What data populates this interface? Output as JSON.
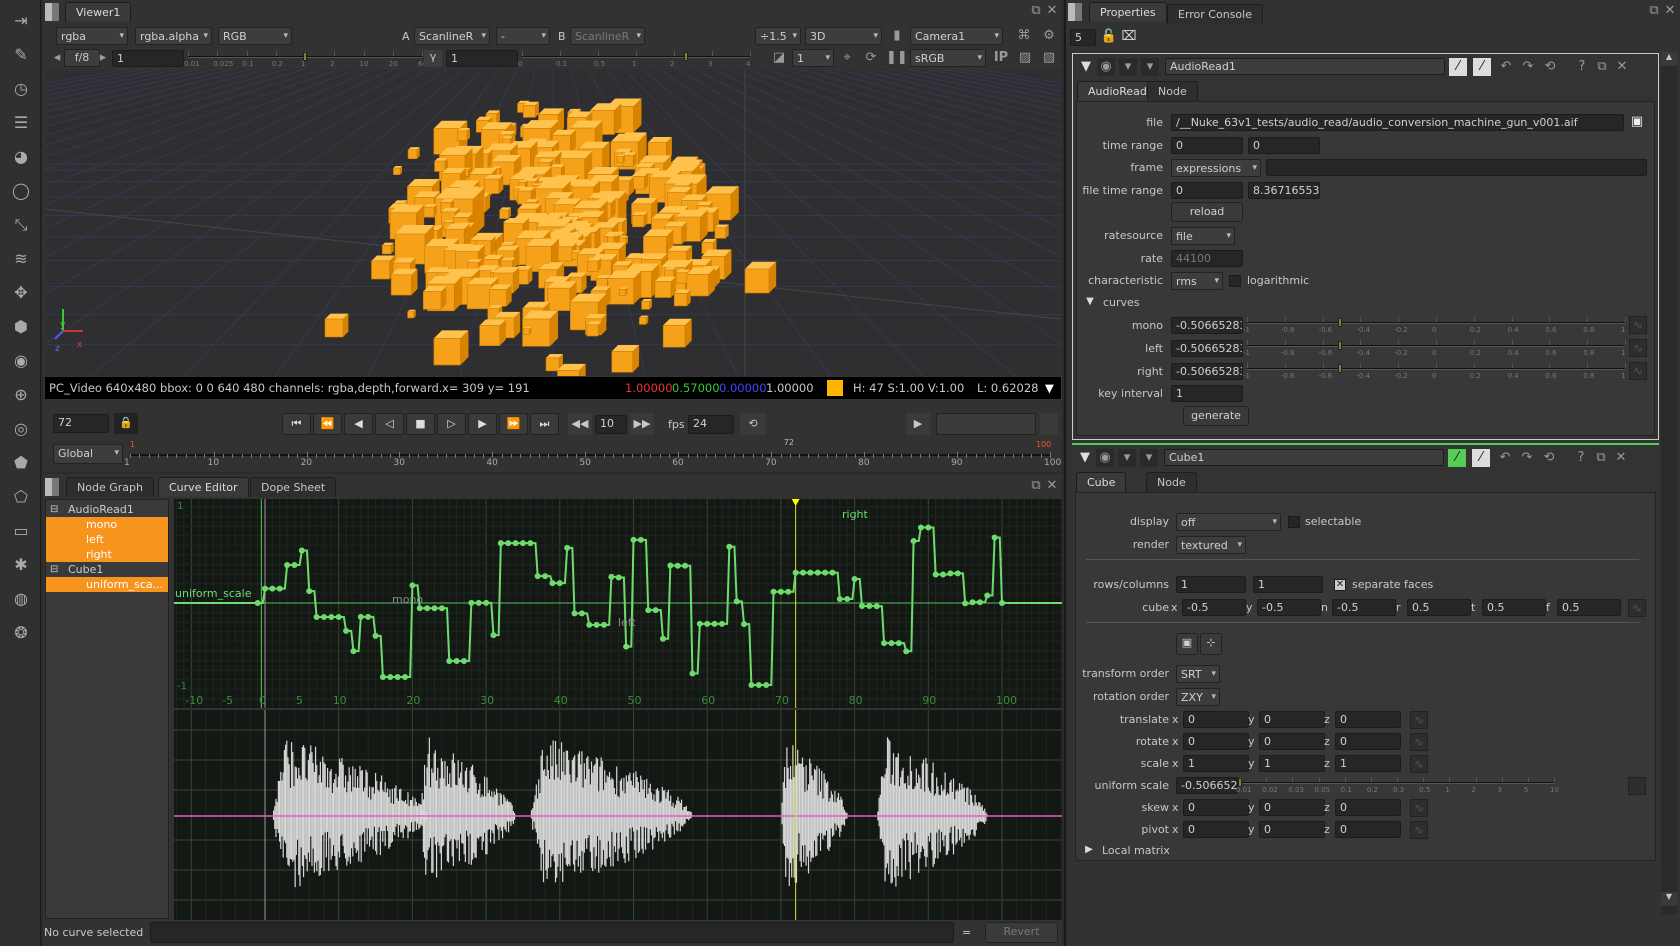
{
  "left_toolbar": {
    "icons": [
      "image-icon",
      "draw-icon",
      "time-icon",
      "channel-icon",
      "color-icon",
      "filter-icon",
      "keyer-icon",
      "merge-icon",
      "transform-icon",
      "3d-icon",
      "views-icon",
      "metadata-icon",
      "toolsets-icon",
      "other-icon",
      "furnace-icon",
      "ofx-icon",
      "nodes-icon",
      "plugins-icon",
      "python-icon"
    ]
  },
  "viewer": {
    "tab": "Viewer1",
    "channels": "rgba",
    "alpha": "rgba.alpha",
    "display_channels": "RGB",
    "a_label": "A",
    "input_a": "ScanlineR",
    "composite": "-",
    "b_label": "B",
    "input_b": "ScanlineR",
    "zoom": "÷1.5",
    "view_mode": "3D",
    "camera": "Camera1",
    "fstop": "f/8",
    "gain": "1",
    "gain_ticks": [
      "0.01",
      "0.025",
      "0.1",
      "0.2",
      "1",
      "2",
      "10",
      "20",
      "64"
    ],
    "gamma_label": "γ",
    "gamma": "1",
    "gamma_ticks": [
      "0",
      "0.1",
      "0.5",
      "1",
      "2",
      "3",
      "4"
    ],
    "proxy": "1",
    "lut": "sRGB",
    "ip": "IP",
    "info": {
      "format": "PC_Video 640x480 bbox: 0 0 640 480 channels: rgba,depth,forward.",
      "coords": "x= 309 y= 191",
      "r": "1.00000",
      "g": "0.57000",
      "b": "0.00000",
      "a": "1.00000",
      "swatch": "#ffb400",
      "hsv": "H: 47 S:1.00 V:1.00",
      "lum": "L: 0.62028"
    },
    "axis": {
      "x": "x",
      "y": "y",
      "z": "z"
    }
  },
  "playback": {
    "frame": "72",
    "increment": "10",
    "fps_label": "fps",
    "fps": "24",
    "range_mode": "Global",
    "timeline_ticks": [
      "1",
      "10",
      "20",
      "30",
      "40",
      "50",
      "60",
      "70",
      "80",
      "90",
      "100"
    ],
    "in_point": "1",
    "out_point": "100",
    "current": "72"
  },
  "curve_editor": {
    "tabs": [
      "Node Graph",
      "Curve Editor",
      "Dope Sheet"
    ],
    "active_tab": 1,
    "tree": [
      {
        "label": "AudioRead1",
        "type": "node"
      },
      {
        "label": "mono",
        "type": "curve"
      },
      {
        "label": "left",
        "type": "curve"
      },
      {
        "label": "right",
        "type": "curve"
      },
      {
        "label": "Cube1",
        "type": "node"
      },
      {
        "label": "uniform_sca...",
        "type": "curve"
      }
    ],
    "x_ticks": [
      "-10",
      "-5",
      "0",
      "5",
      "10",
      "20",
      "30",
      "40",
      "50",
      "60",
      "70",
      "80",
      "90",
      "100"
    ],
    "y_ticks": [
      "1",
      "-1"
    ],
    "curve_labels": {
      "uniform": "uniform_scale",
      "mono": "mono",
      "left": "left",
      "right": "right"
    },
    "curve_color": "#6ddc6d",
    "wave_color": "#d8d8d8",
    "zero_line_color": "#e060c0",
    "status": "No curve selected",
    "eq": "=",
    "revert": "Revert"
  },
  "properties": {
    "tabs": [
      "Properties",
      "Error Console"
    ],
    "max_panels": "5",
    "audioread": {
      "name": "AudioRead1",
      "tabs": [
        "AudioRead",
        "Node"
      ],
      "rows": [
        {
          "label": "file",
          "type": "text",
          "value": "/__Nuke_63v1_tests/audio_read/audio_conversion_machine_gun_v001.aif"
        },
        {
          "label": "time range",
          "type": "pair",
          "values": [
            "0",
            "0"
          ]
        },
        {
          "label": "frame",
          "type": "ddtext",
          "value": "expressions",
          "text": ""
        },
        {
          "label": "file time range",
          "type": "pair",
          "values": [
            "0",
            "8.36716553"
          ]
        },
        {
          "label": "",
          "type": "button",
          "value": "reload"
        },
        {
          "label": "ratesource",
          "type": "dd",
          "value": "file"
        },
        {
          "label": "rate",
          "type": "disabled",
          "value": "44100"
        },
        {
          "label": "characteristic",
          "type": "ddcheck",
          "value": "rms",
          "check_label": "logarithmic",
          "checked": false
        },
        {
          "label": "curves",
          "type": "section",
          "open": true
        },
        {
          "label": "mono",
          "type": "slider",
          "value": "-0.50665283",
          "fraction": -0.5066
        },
        {
          "label": "left",
          "type": "slider",
          "value": "-0.50665283",
          "fraction": -0.5066
        },
        {
          "label": "right",
          "type": "slider",
          "value": "-0.50665283",
          "fraction": -0.5066
        },
        {
          "label": "key interval",
          "type": "single",
          "value": "1"
        },
        {
          "label": "",
          "type": "button",
          "value": "generate"
        }
      ],
      "slider_ticks": [
        "-1",
        "-0.8",
        "-0.6",
        "-0.4",
        "-0.2",
        "0",
        "0.2",
        "0.4",
        "0.6",
        "0.8",
        "1"
      ]
    },
    "cube": {
      "name": "Cube1",
      "tabs": [
        "Cube",
        "Node"
      ],
      "display": {
        "label": "display",
        "value": "off",
        "check_label": "selectable",
        "checked": false
      },
      "render": {
        "label": "render",
        "value": "textured"
      },
      "rows_columns": {
        "label": "rows/columns",
        "values": [
          "1",
          "1"
        ],
        "check_label": "separate faces",
        "checked": true
      },
      "cube": {
        "label": "cube",
        "fields": [
          {
            "k": "x",
            "v": "-0.5"
          },
          {
            "k": "y",
            "v": "-0.5"
          },
          {
            "k": "n",
            "v": "-0.5"
          },
          {
            "k": "r",
            "v": "0.5"
          },
          {
            "k": "t",
            "v": "0.5"
          },
          {
            "k": "f",
            "v": "0.5"
          }
        ]
      },
      "transform_order": {
        "label": "transform order",
        "value": "SRT"
      },
      "rotation_order": {
        "label": "rotation order",
        "value": "ZXY"
      },
      "xyz": [
        {
          "label": "translate",
          "values": [
            "0",
            "0",
            "0"
          ]
        },
        {
          "label": "rotate",
          "values": [
            "0",
            "0",
            "0"
          ]
        },
        {
          "label": "scale",
          "values": [
            "1",
            "1",
            "1"
          ]
        },
        {
          "label": "uniform scale",
          "type": "slider",
          "value": "-0.50665283"
        },
        {
          "label": "skew",
          "values": [
            "0",
            "0",
            "0"
          ]
        },
        {
          "label": "pivot",
          "values": [
            "0",
            "0",
            "0"
          ]
        }
      ],
      "uniform_ticks": [
        "0.01",
        "0.02",
        "0.03",
        "0.05",
        "0.1",
        "0.2",
        "0.3",
        "0.5",
        "1",
        "2",
        "3",
        "5",
        "10"
      ],
      "local_matrix": "Local matrix"
    }
  }
}
